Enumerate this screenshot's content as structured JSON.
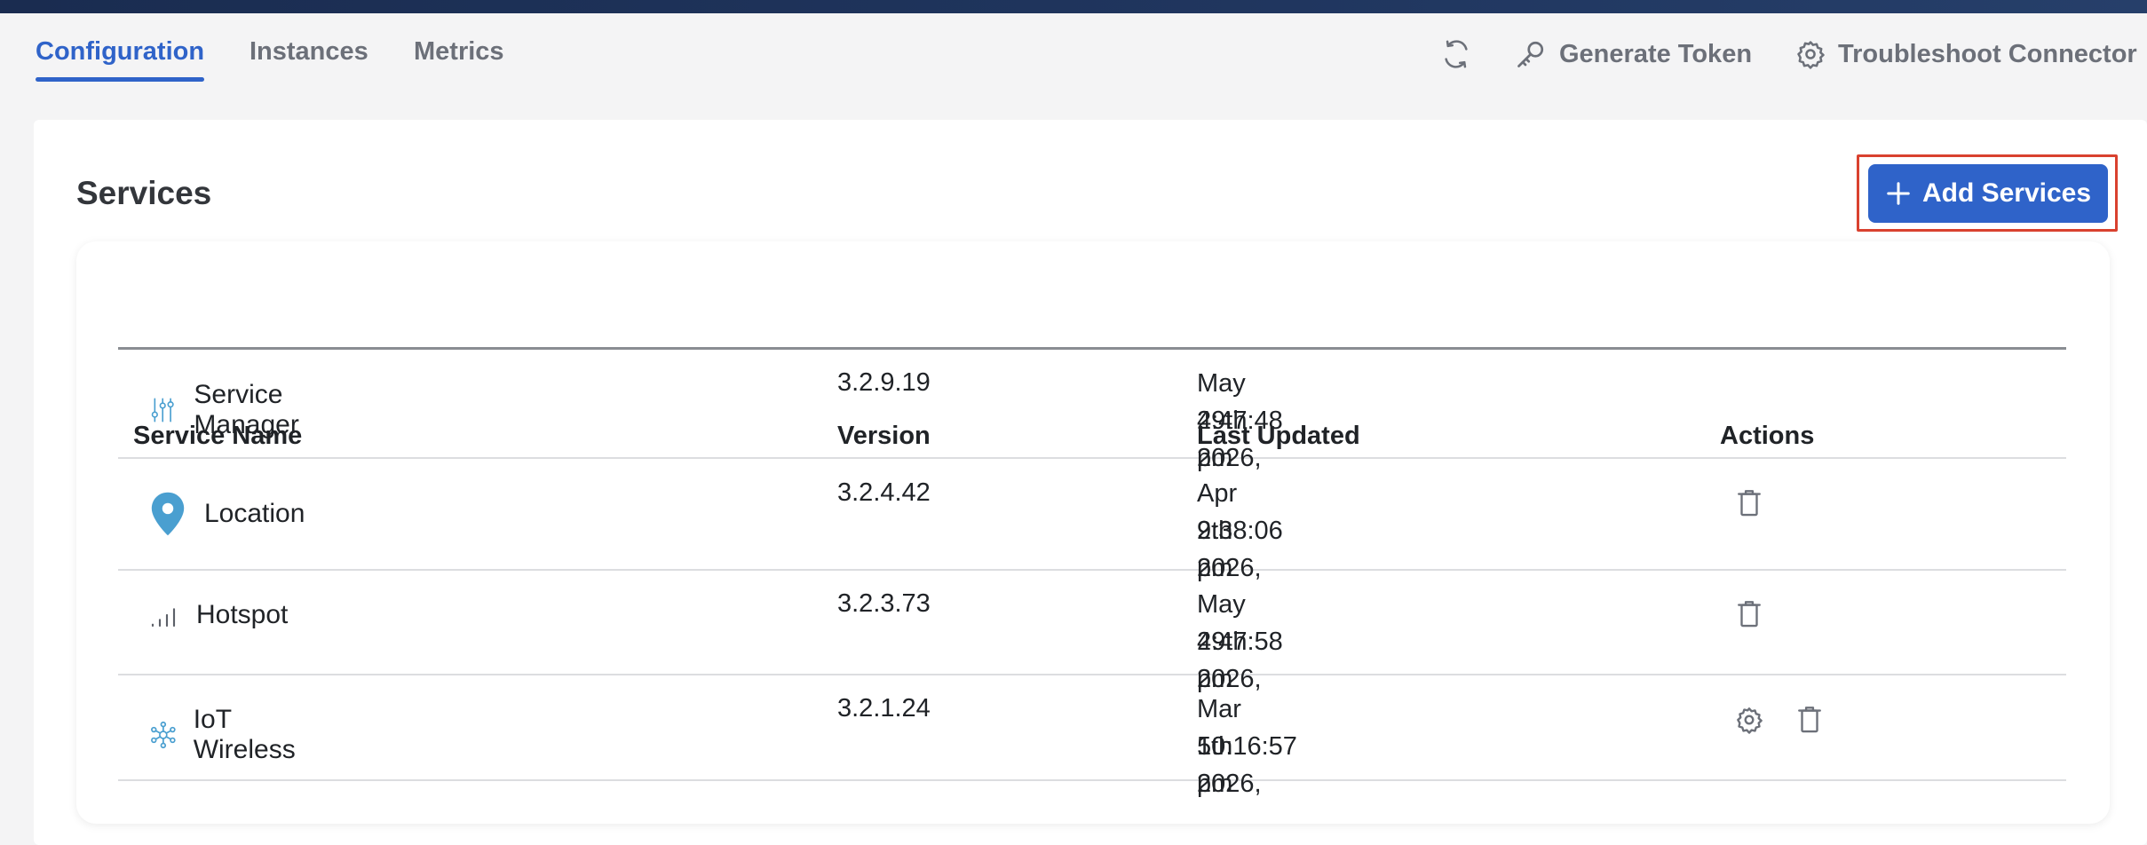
{
  "tabs": [
    {
      "label": "Configuration",
      "active": true
    },
    {
      "label": "Instances",
      "active": false
    },
    {
      "label": "Metrics",
      "active": false
    }
  ],
  "toolbar": {
    "refresh_icon": "refresh-icon",
    "generate_token_label": "Generate Token",
    "troubleshoot_label": "Troubleshoot Connector"
  },
  "section": {
    "title": "Services",
    "add_button_label": "Add Services"
  },
  "table": {
    "headers": [
      "Service Name",
      "Version",
      "Last Updated",
      "Actions"
    ],
    "rows": [
      {
        "name": "Service Manager",
        "icon": "sliders-icon",
        "version": "3.2.9.19",
        "date": "May 29th 2026,",
        "time": "4:47:48 pm",
        "actions": []
      },
      {
        "name": "Location",
        "icon": "location-pin-icon",
        "version": "3.2.4.42",
        "date": "Apr 9th 2026,",
        "time": "2:38:06 pm",
        "actions": [
          "delete"
        ]
      },
      {
        "name": "Hotspot",
        "icon": "signal-bars-icon",
        "version": "3.2.3.73",
        "date": "May 29th 2026,",
        "time": "4:47:58 pm",
        "actions": [
          "delete"
        ]
      },
      {
        "name": "IoT Wireless",
        "icon": "network-hub-icon",
        "version": "3.2.1.24",
        "date": "Mar 5th 2026,",
        "time": "10:16:57 pm",
        "actions": [
          "settings",
          "delete"
        ]
      }
    ]
  },
  "colors": {
    "accent": "#2f63c9",
    "highlight_outline": "#d9412f",
    "icon_blue": "#4a9fd0"
  }
}
